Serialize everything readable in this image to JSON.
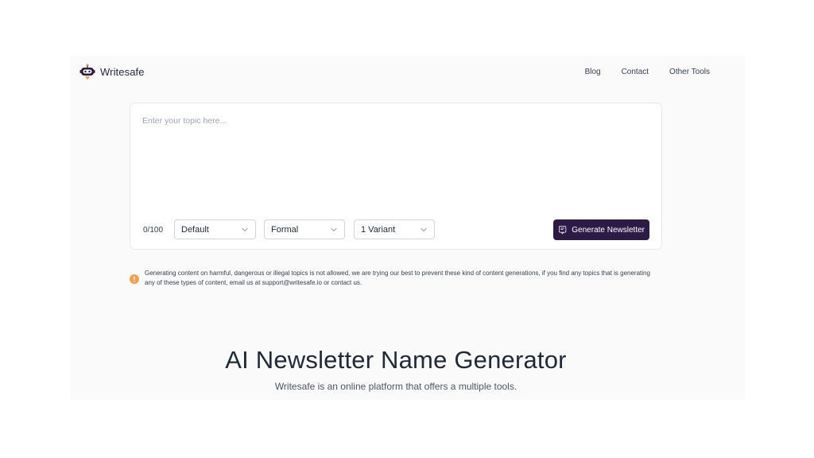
{
  "header": {
    "brand_name": "Writesafe",
    "logo_icon": "robot-logo-icon",
    "nav": [
      {
        "label": "Blog"
      },
      {
        "label": "Contact"
      },
      {
        "label": "Other Tools"
      }
    ]
  },
  "form": {
    "topic_placeholder": "Enter your topic here...",
    "topic_value": "",
    "char_count": "0/100",
    "selects": [
      {
        "value": "Default"
      },
      {
        "value": "Formal"
      },
      {
        "value": "1 Variant"
      }
    ],
    "generate_label": "Generate Newsletter",
    "generate_icon": "generate-document-icon"
  },
  "notice": {
    "icon": "warning-circle-icon",
    "text": "Generating content on harmful, dangerous or illegal topics is not allowed, we are trying our best to prevent these kind of content generations, if you find any topics that is generating any of these types of content, email us at support@writesafe.io or contact us."
  },
  "hero": {
    "title": "AI Newsletter Name Generator",
    "subtitle": "Writesafe is an online platform that offers a multiple tools."
  },
  "colors": {
    "accent": "#2e1a47",
    "warning": "#f59e4c",
    "page_bg": "#fafafa"
  }
}
